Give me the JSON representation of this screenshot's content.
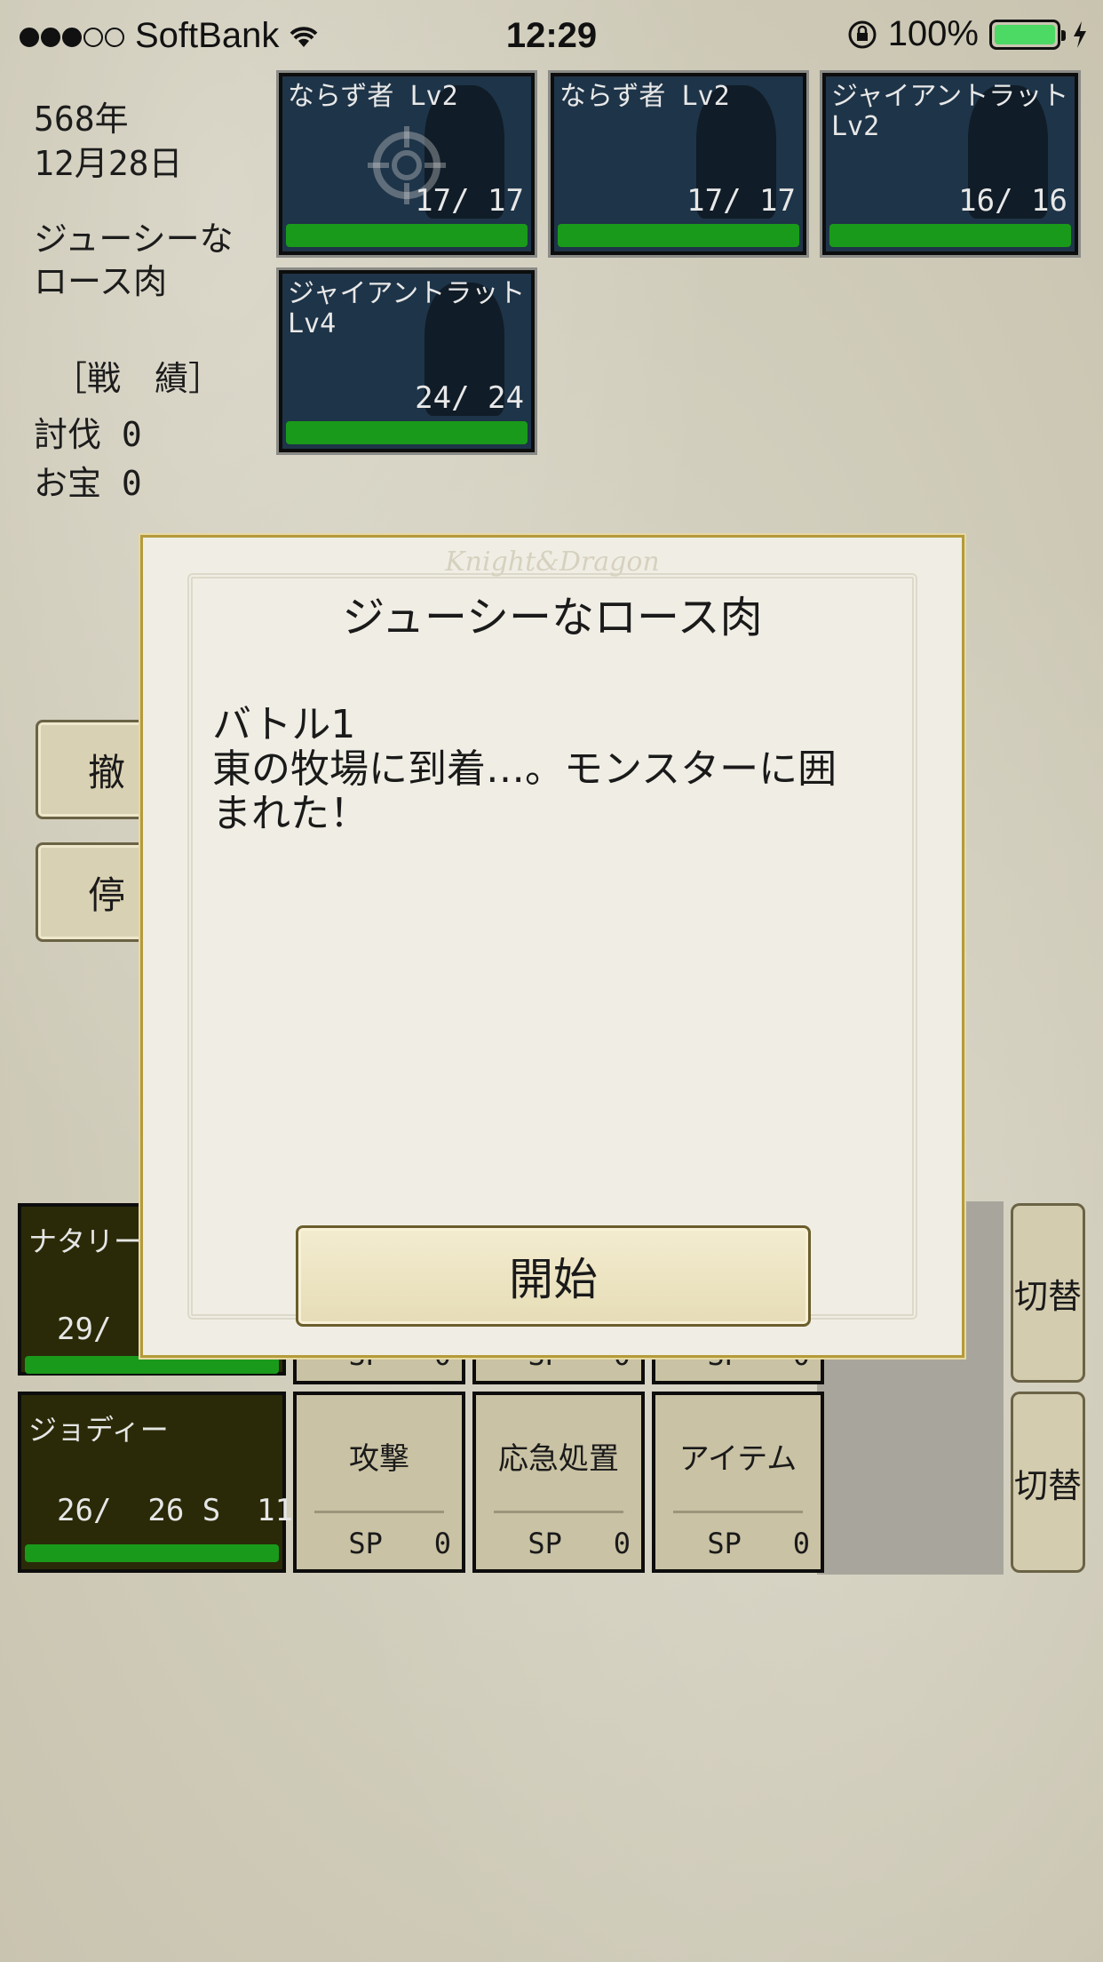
{
  "status_bar": {
    "carrier": "SoftBank",
    "time": "12:29",
    "battery": "100%",
    "icons": [
      "signal-dots-icon",
      "wifi-icon",
      "orientation-lock-icon",
      "battery-icon",
      "charging-icon"
    ]
  },
  "info": {
    "date_year": "568年",
    "date_day": "12月28日",
    "quest_line1": "ジューシーな",
    "quest_line2": "ロース肉",
    "record_header": "［戦　績］",
    "kills": "討伐 0",
    "treasure": "お宝 0"
  },
  "enemies": [
    {
      "name": "ならず者 Lv2",
      "hp": "17/  17",
      "hp_fraction": 1.0
    },
    {
      "name": "ならず者 Lv2",
      "hp": "17/  17",
      "hp_fraction": 1.0
    },
    {
      "name": "ジャイアントラット Lv2",
      "hp": "16/  16",
      "hp_fraction": 1.0
    },
    {
      "name": "ジャイアントラット Lv4",
      "hp": "24/  24",
      "hp_fraction": 1.0
    }
  ],
  "side_buttons": {
    "retreat": "撤",
    "stop": "停"
  },
  "party": [
    {
      "name": "ナタリー",
      "stat": "29/",
      "hp_fraction": 1.0,
      "skills": [
        {
          "sp": "SP   0"
        },
        {
          "sp": "SP   0"
        },
        {
          "sp": "SP   0"
        }
      ],
      "switch": "切替"
    },
    {
      "name": "ジョディー",
      "stat": "26/  26 S  11",
      "hp_fraction": 1.0,
      "skills": [
        {
          "label": "攻撃",
          "sp": "SP   0"
        },
        {
          "label": "応急処置",
          "sp": "SP   0"
        },
        {
          "label": "アイテム",
          "sp": "SP   0"
        }
      ],
      "switch": "切替"
    }
  ],
  "modal": {
    "brand": "Knight&Dragon",
    "title": "ジューシーなロース肉",
    "body": "バトル1\n東の牧場に到着…。モンスターに囲\nまれた！",
    "start_button": "開始"
  },
  "colors": {
    "hp_bar": "#1a9a1a",
    "enemy_card": "#1e3448",
    "modal_border": "#b59a3a"
  }
}
